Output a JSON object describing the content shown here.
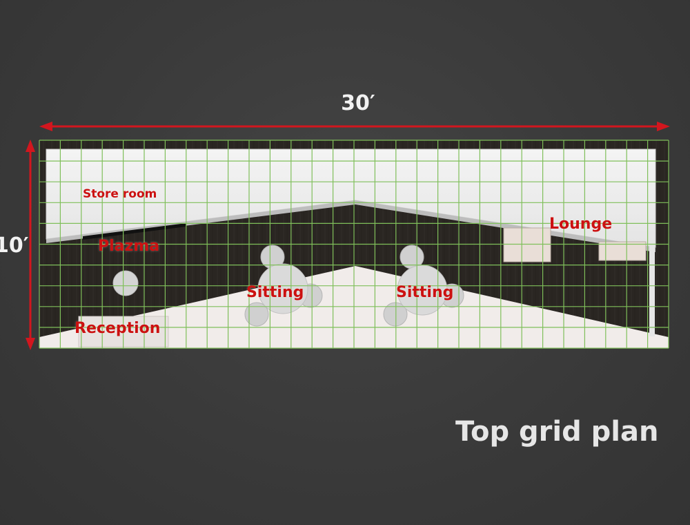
{
  "dimensions": {
    "width_label": "30′",
    "height_label": "10′"
  },
  "rooms": {
    "store_room": "Store room",
    "plazma": "Plazma",
    "reception": "Reception",
    "sitting_left": "Sitting",
    "sitting_right": "Sitting",
    "lounge": "Lounge"
  },
  "title": "Top grid plan",
  "colors": {
    "background": "#3b3b3b",
    "dimension_arrow": "#d2161e",
    "grid_line": "#7fbf5a",
    "label_text": "#cc1111",
    "floor_dark": "#2b2723",
    "wall_panel": "#efefef",
    "floor_light": "#f1ecea"
  },
  "icons": {
    "dimension_arrows": "double-headed-arrow"
  }
}
